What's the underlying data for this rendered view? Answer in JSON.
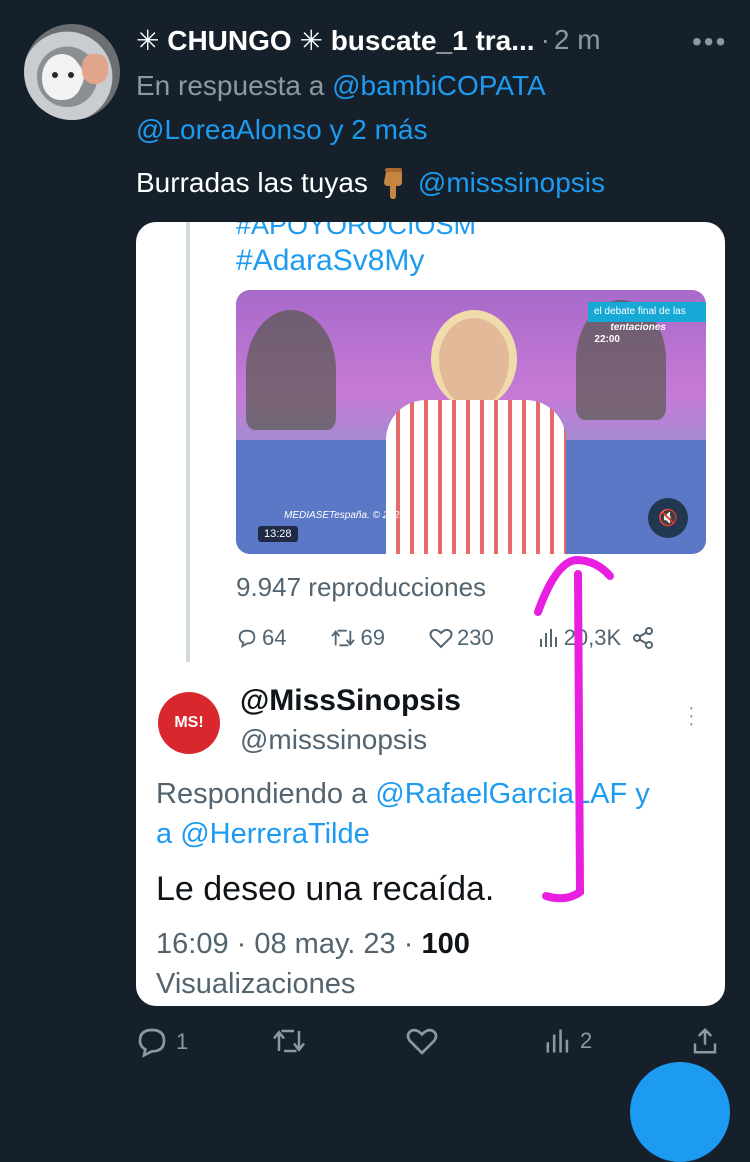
{
  "header": {
    "display_name": "✳ CHUNGO ✳ buscate_1 tra...",
    "separator": "·",
    "time": "2 m",
    "more_label": "•••"
  },
  "reply_context": {
    "prefix": "En respuesta a",
    "mention_1": "@bambiCOPATA",
    "mention_2": "@LoreaAlonso",
    "suffix": "y 2 más"
  },
  "tweet": {
    "text": "Burradas las tuyas",
    "mention": "@misssinopsis"
  },
  "embedded_screenshot": {
    "hashtag_partial": "#APOYOROCIOSM",
    "hashtag": "#AdaraSv8My",
    "video": {
      "badge_line1": "el debate final de las",
      "badge_line2": "tentaciones",
      "badge_time": "22:00",
      "watermark": "MEDIASETespaña. © 2023",
      "duration": "13:28"
    },
    "views": "9.947 reproducciones",
    "stats": {
      "replies": "64",
      "retweets": "69",
      "likes": "230",
      "views": "20,3K"
    },
    "quoted": {
      "avatar_text": "MS!",
      "name": "@MissSinopsis",
      "handle": "@misssinopsis",
      "reply_prefix": "Respondiendo a",
      "reply_mention_1": "@RafaelGarciaLAF",
      "reply_mid": "y",
      "reply_a": "a",
      "reply_mention_2": "@HerreraTilde",
      "text": "Le deseo una recaída.",
      "time": "16:09 · 08 may. 23 ·",
      "views_count": "100",
      "views_label": "Visualizaciones"
    }
  },
  "actions": {
    "replies": "1",
    "retweets": "",
    "likes": "",
    "views": "2"
  },
  "colors": {
    "background": "#15202b",
    "accent": "#1d9bf0",
    "muted": "#8b98a5",
    "annotation": "#e81ee0"
  }
}
